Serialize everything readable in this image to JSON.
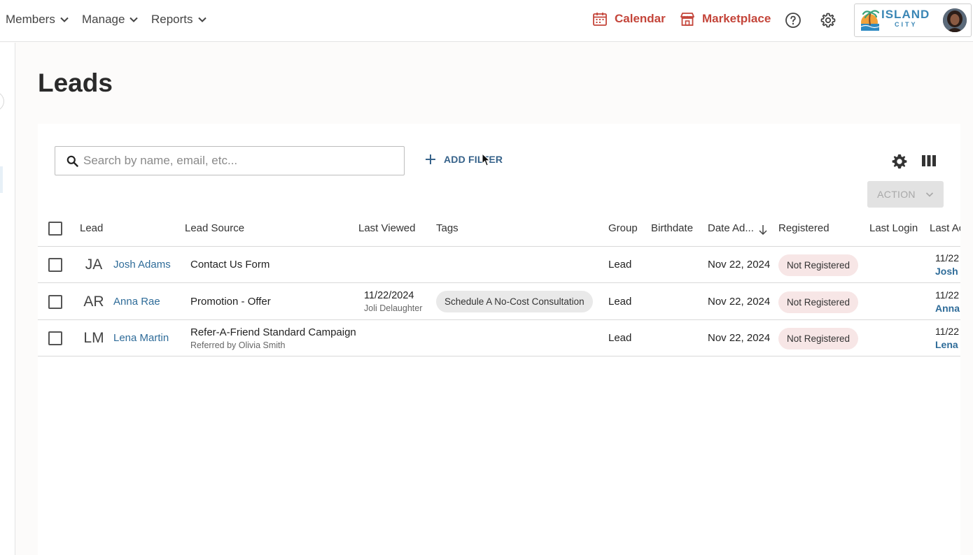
{
  "nav": {
    "members": "Members",
    "manage": "Manage",
    "reports": "Reports",
    "calendar": "Calendar",
    "marketplace": "Marketplace"
  },
  "brand": {
    "name": "ISLAND",
    "sub": "CITY"
  },
  "page": {
    "title": "Leads"
  },
  "toolbar": {
    "search_placeholder": "Search by name, email, etc...",
    "add_filter": "ADD FILTER",
    "action": "ACTION"
  },
  "table": {
    "columns": [
      "Lead",
      "Lead Source",
      "Last Viewed",
      "Tags",
      "Group",
      "Birthdate",
      "Date Ad...",
      "Registered",
      "Last Login",
      "Last Ac"
    ],
    "rows": [
      {
        "initials": "JA",
        "name": "Josh Adams",
        "source": "Contact Us Form",
        "source_sub": "",
        "last_viewed": "",
        "last_viewed_by": "",
        "tag": "",
        "group": "Lead",
        "date_added": "Nov 22, 2024",
        "registered": "Not Registered",
        "last_activity_date": "11/22",
        "last_activity_name": "Josh A"
      },
      {
        "initials": "AR",
        "name": "Anna Rae",
        "source": "Promotion - Offer",
        "source_sub": "",
        "last_viewed": "11/22/2024",
        "last_viewed_by": "Joli Delaughter",
        "tag": "Schedule A No-Cost Consultation",
        "group": "Lead",
        "date_added": "Nov 22, 2024",
        "registered": "Not Registered",
        "last_activity_date": "11/22",
        "last_activity_name": "Anna"
      },
      {
        "initials": "LM",
        "name": "Lena Martin",
        "source": "Refer-A-Friend Standard Campaign",
        "source_sub": "Referred by Olivia Smith",
        "last_viewed": "",
        "last_viewed_by": "",
        "tag": "",
        "group": "Lead",
        "date_added": "Nov 22, 2024",
        "registered": "Not Registered",
        "last_activity_date": "11/22",
        "last_activity_name": "Lena"
      }
    ]
  },
  "colors": {
    "accent": "#c4453a",
    "link": "#2f6c99",
    "badge_bg": "#f7e6e6",
    "tag_bg": "#e9e9e9"
  }
}
